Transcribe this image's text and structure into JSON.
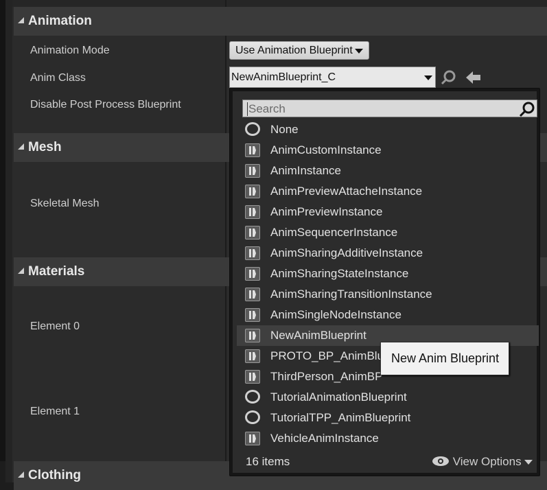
{
  "categories": {
    "animation": "Animation",
    "mesh": "Mesh",
    "materials": "Materials",
    "clothing": "Clothing"
  },
  "properties": {
    "animation_mode": "Animation Mode",
    "anim_class": "Anim Class",
    "disable_post_process": "Disable Post Process Blueprint",
    "skeletal_mesh": "Skeletal Mesh",
    "element_0": "Element 0",
    "element_1": "Element 1"
  },
  "animation_mode_value": "Use Animation Blueprint",
  "anim_class_value": "NewAnimBlueprint_C",
  "picker": {
    "search_placeholder": "Search",
    "items": [
      {
        "label": "None",
        "icon": "none-circle-icon"
      },
      {
        "label": "AnimCustomInstance",
        "icon": "anim-blueprint-icon"
      },
      {
        "label": "AnimInstance",
        "icon": "anim-blueprint-icon"
      },
      {
        "label": "AnimPreviewAttacheInstance",
        "icon": "anim-blueprint-icon"
      },
      {
        "label": "AnimPreviewInstance",
        "icon": "anim-blueprint-icon"
      },
      {
        "label": "AnimSequencerInstance",
        "icon": "anim-blueprint-icon"
      },
      {
        "label": "AnimSharingAdditiveInstance",
        "icon": "anim-blueprint-icon"
      },
      {
        "label": "AnimSharingStateInstance",
        "icon": "anim-blueprint-icon"
      },
      {
        "label": "AnimSharingTransitionInstance",
        "icon": "anim-blueprint-icon"
      },
      {
        "label": "AnimSingleNodeInstance",
        "icon": "anim-blueprint-icon"
      },
      {
        "label": "NewAnimBlueprint",
        "icon": "anim-blueprint-icon",
        "selected": true
      },
      {
        "label": "PROTO_BP_AnimBlu",
        "icon": "anim-blueprint-icon"
      },
      {
        "label": "ThirdPerson_AnimBP",
        "icon": "anim-blueprint-icon"
      },
      {
        "label": "TutorialAnimationBlueprint",
        "icon": "none-circle-icon"
      },
      {
        "label": "TutorialTPP_AnimBlueprint",
        "icon": "none-circle-icon"
      },
      {
        "label": "VehicleAnimInstance",
        "icon": "anim-blueprint-icon"
      }
    ],
    "count_label": "16 items",
    "view_options": "View Options"
  },
  "tooltip": "New Anim Blueprint",
  "colors": {
    "panel": "#2b2b2b",
    "category": "#3a3a3a",
    "selected_row": "#3f3f3f"
  }
}
